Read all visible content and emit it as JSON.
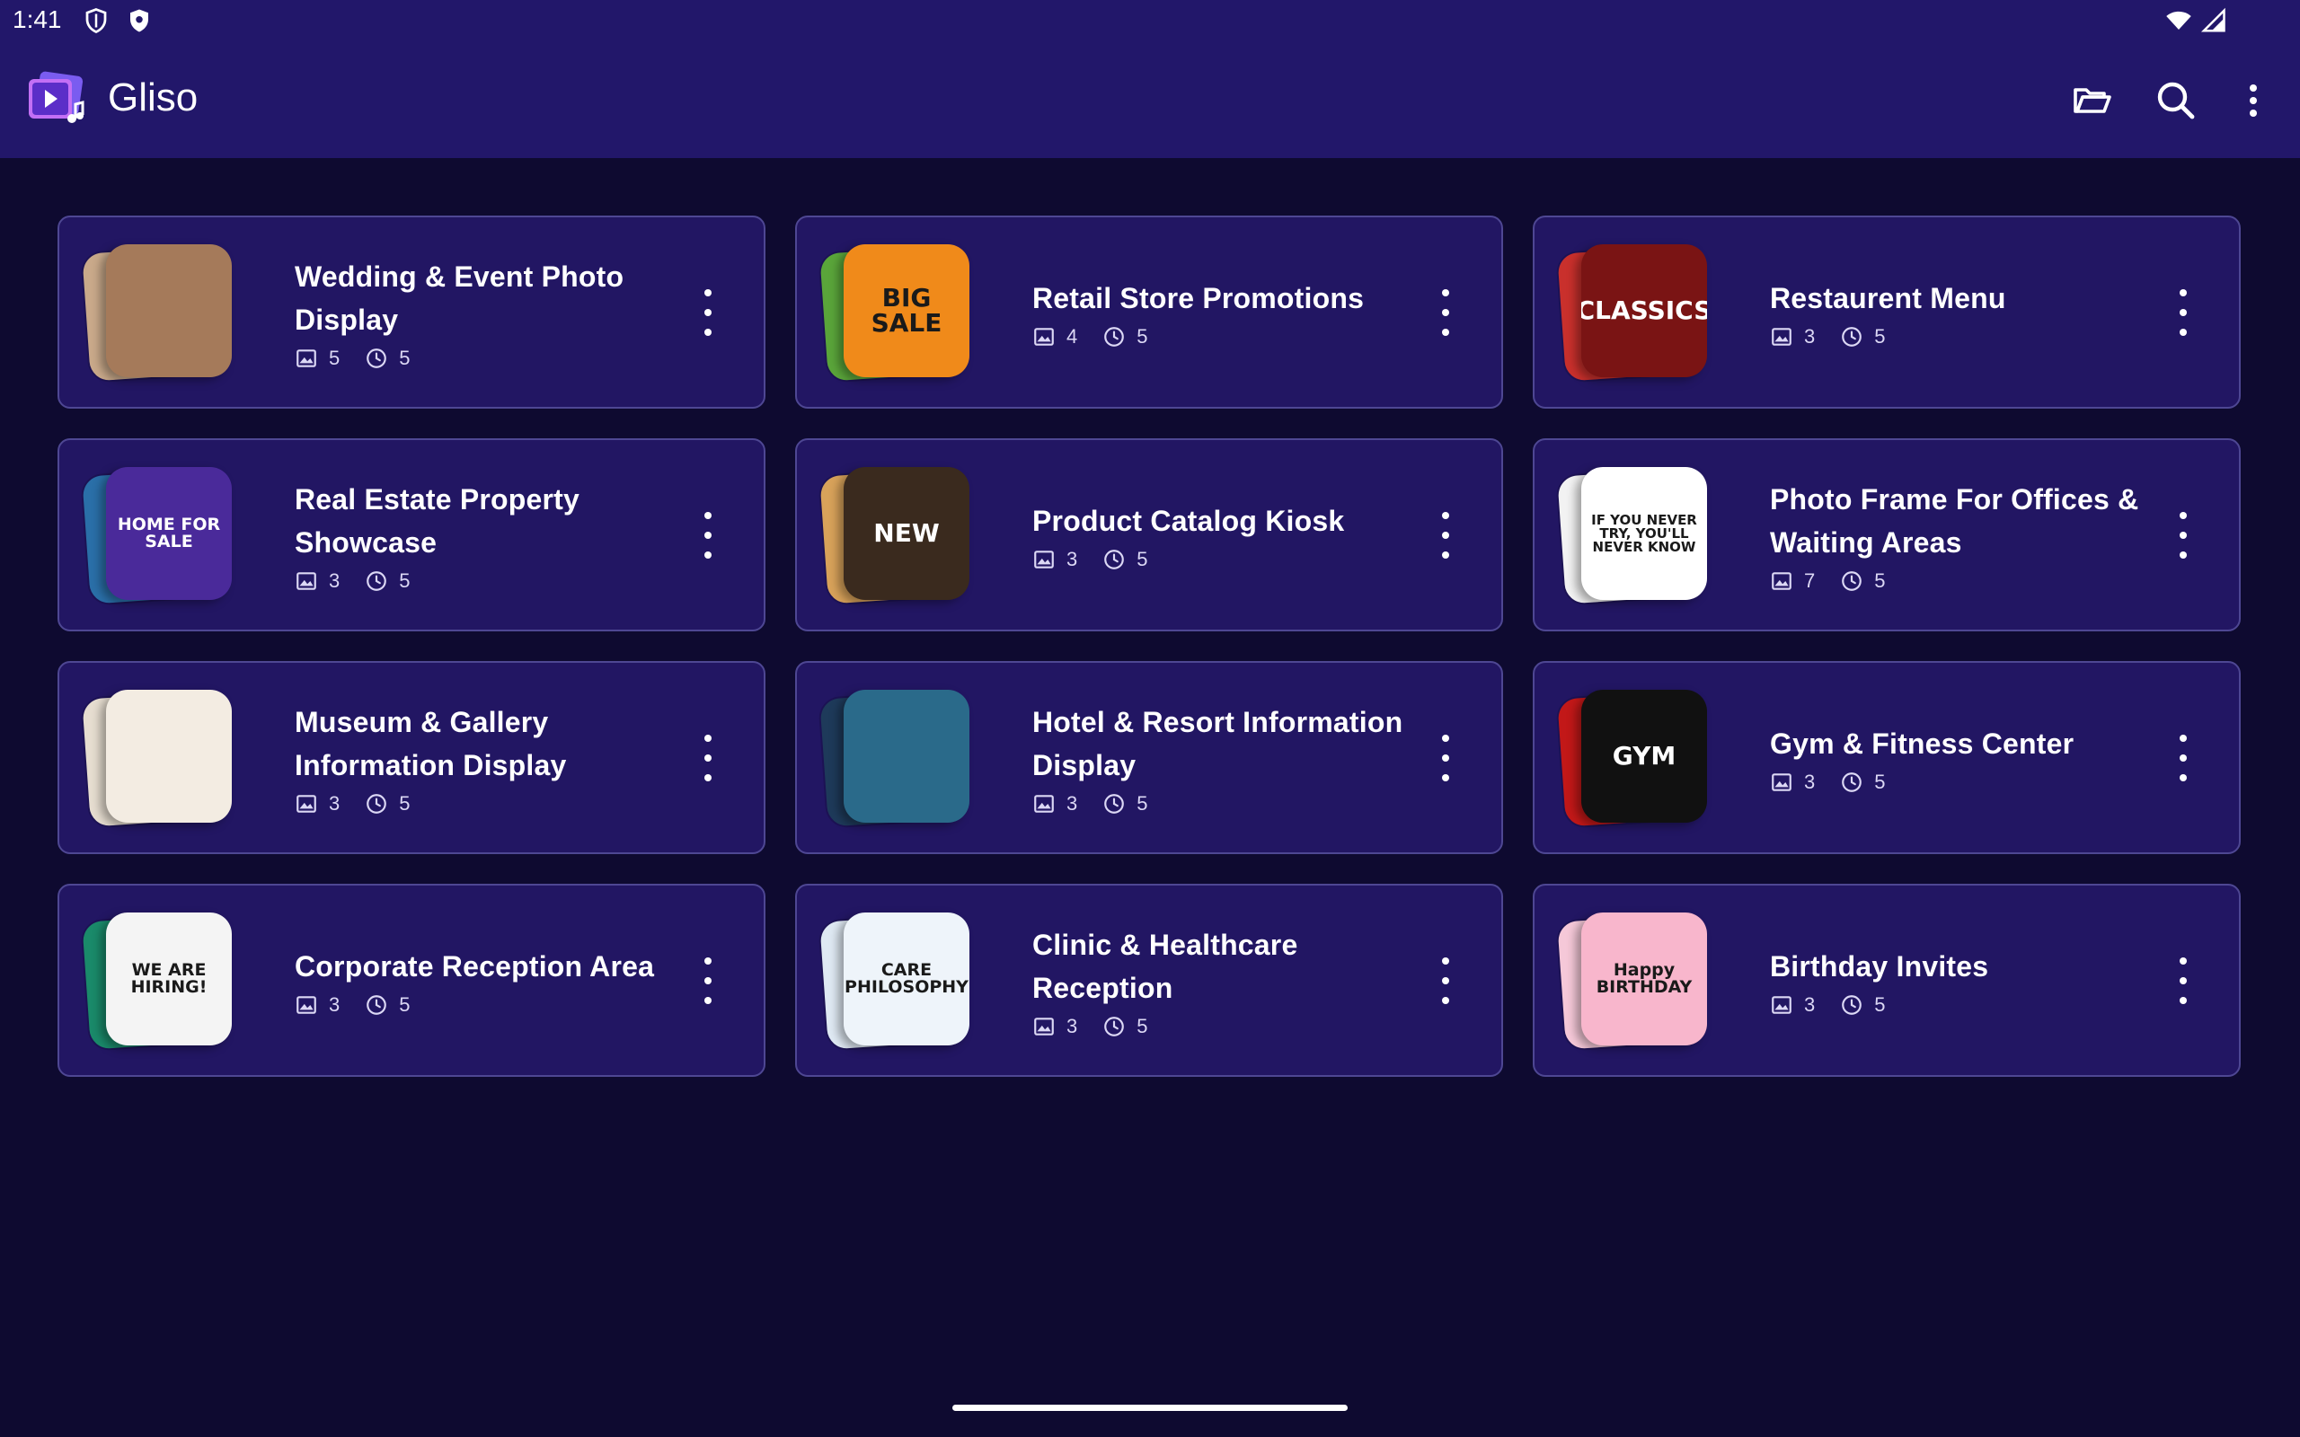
{
  "status_bar": {
    "time": "1:41",
    "icons": [
      "shield-outline-icon",
      "shield-filled-icon",
      "wifi-icon",
      "signal-icon"
    ]
  },
  "app_bar": {
    "title": "Gliso",
    "actions": [
      "folder-open-icon",
      "search-icon",
      "more-vertical-icon"
    ]
  },
  "colors": {
    "background": "#0e0a30",
    "app_bar": "#22176a",
    "card": "#221663",
    "card_border": "#4e4793"
  },
  "cards": [
    {
      "title": "Wedding & Event Photo Display",
      "images": "5",
      "duration": "5",
      "thumb_text": "",
      "thumb_colors": [
        "#c9a98a",
        "#a57a5a"
      ]
    },
    {
      "title": "Retail Store Promotions",
      "images": "4",
      "duration": "5",
      "thumb_text": "BIG SALE",
      "thumb_colors": [
        "#5aa53a",
        "#f08a1a"
      ]
    },
    {
      "title": "Restaurent Menu",
      "images": "3",
      "duration": "5",
      "thumb_text": "CLASSICS",
      "thumb_colors": [
        "#c9302c",
        "#7a1414"
      ]
    },
    {
      "title": "Real Estate Property Showcase",
      "images": "3",
      "duration": "5",
      "thumb_text": "HOME FOR SALE",
      "thumb_colors": [
        "#2a6fa8",
        "#4a2a9a"
      ]
    },
    {
      "title": "Product Catalog Kiosk",
      "images": "3",
      "duration": "5",
      "thumb_text": "NEW",
      "thumb_colors": [
        "#d8a25a",
        "#3a2a1e"
      ]
    },
    {
      "title": "Photo Frame For Offices & Waiting Areas",
      "images": "7",
      "duration": "5",
      "thumb_text": "IF YOU NEVER TRY, YOU'LL NEVER KNOW",
      "thumb_colors": [
        "#f2f2f2",
        "#ffffff"
      ]
    },
    {
      "title": "Museum & Gallery Information Display",
      "images": "3",
      "duration": "5",
      "thumb_text": "",
      "thumb_colors": [
        "#e6ddd0",
        "#f3ece2"
      ]
    },
    {
      "title": "Hotel & Resort Information Display",
      "images": "3",
      "duration": "5",
      "thumb_text": "",
      "thumb_colors": [
        "#1e3a5a",
        "#2a6a8a"
      ]
    },
    {
      "title": "Gym & Fitness Center",
      "images": "3",
      "duration": "5",
      "thumb_text": "GYM",
      "thumb_colors": [
        "#c21818",
        "#111111"
      ]
    },
    {
      "title": "Corporate Reception Area",
      "images": "3",
      "duration": "5",
      "thumb_text": "WE ARE HIRING!",
      "thumb_colors": [
        "#1a8a6a",
        "#f4f4f4"
      ]
    },
    {
      "title": "Clinic & Healthcare Reception",
      "images": "3",
      "duration": "5",
      "thumb_text": "CARE PHILOSOPHY",
      "thumb_colors": [
        "#dfe9f3",
        "#eef4fa"
      ]
    },
    {
      "title": "Birthday Invites",
      "images": "3",
      "duration": "5",
      "thumb_text": "Happy BIRTHDAY",
      "thumb_colors": [
        "#f5c8d8",
        "#f8b6cc"
      ]
    }
  ]
}
